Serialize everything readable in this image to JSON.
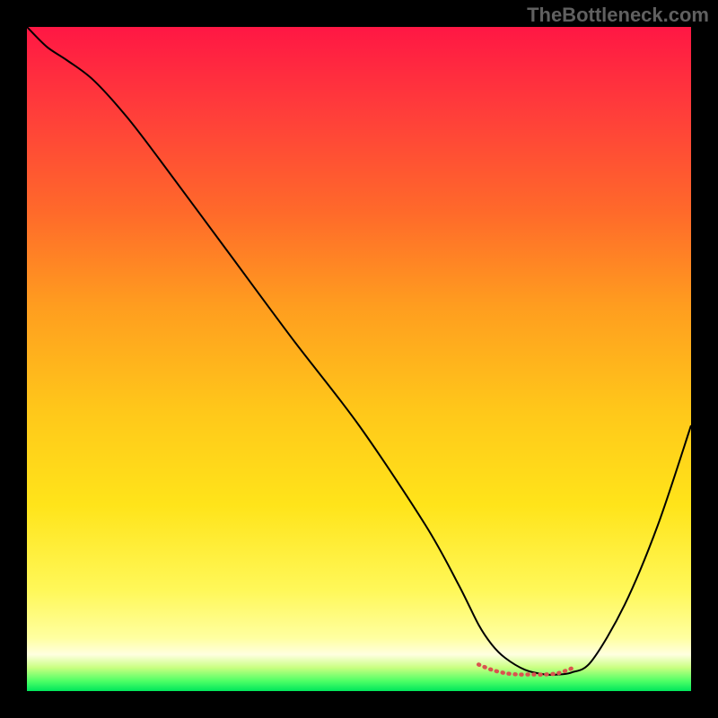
{
  "watermark": "TheBottleneck.com",
  "chart_data": {
    "type": "line",
    "title": "",
    "xlabel": "",
    "ylabel": "",
    "xlim": [
      0,
      100
    ],
    "ylim": [
      0,
      100
    ],
    "legend": false,
    "grid": false,
    "background_gradient": {
      "stops": [
        {
          "offset": 0.0,
          "color": "#ff1744"
        },
        {
          "offset": 0.12,
          "color": "#ff3b3b"
        },
        {
          "offset": 0.28,
          "color": "#ff6a2a"
        },
        {
          "offset": 0.42,
          "color": "#ff9d1f"
        },
        {
          "offset": 0.58,
          "color": "#ffc81a"
        },
        {
          "offset": 0.72,
          "color": "#ffe41a"
        },
        {
          "offset": 0.85,
          "color": "#fff85a"
        },
        {
          "offset": 0.92,
          "color": "#ffffa0"
        },
        {
          "offset": 0.945,
          "color": "#ffffe0"
        },
        {
          "offset": 0.965,
          "color": "#c8ff80"
        },
        {
          "offset": 0.985,
          "color": "#4dff66"
        },
        {
          "offset": 1.0,
          "color": "#00e65c"
        }
      ]
    },
    "series": [
      {
        "name": "bottleneck-curve",
        "color": "#000000",
        "width": 2,
        "x": [
          0,
          3,
          6,
          10,
          15,
          20,
          30,
          40,
          50,
          60,
          65,
          68,
          70,
          72,
          75,
          78,
          80,
          82,
          85,
          90,
          95,
          100
        ],
        "y": [
          100,
          97,
          95,
          92,
          86.5,
          80,
          66.5,
          53,
          40,
          25,
          16,
          10,
          7,
          5,
          3.2,
          2.5,
          2.5,
          2.8,
          4.5,
          13,
          25,
          40
        ]
      },
      {
        "name": "optimal-range-marker",
        "color": "#d9534f",
        "width": 4.5,
        "dash": [
          1,
          6
        ],
        "linecap": "round",
        "x": [
          68,
          70,
          72,
          74,
          76,
          78,
          80,
          82
        ],
        "y": [
          4.0,
          3.2,
          2.7,
          2.5,
          2.5,
          2.5,
          2.7,
          3.4
        ]
      }
    ]
  }
}
